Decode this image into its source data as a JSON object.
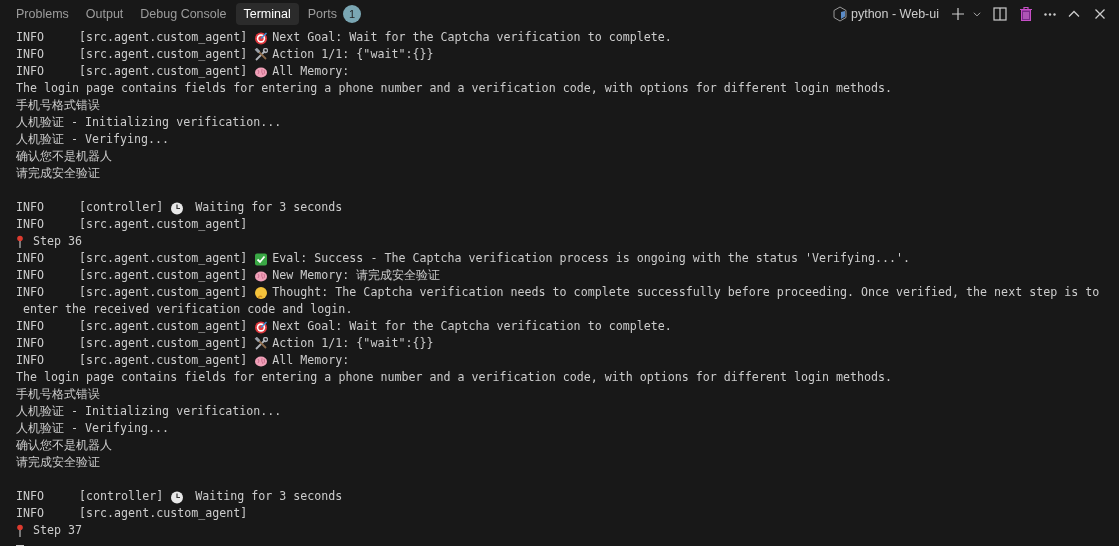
{
  "panel_tabs": [
    {
      "label": "Problems",
      "selected": false
    },
    {
      "label": "Output",
      "selected": false
    },
    {
      "label": "Debug Console",
      "selected": false
    },
    {
      "label": "Terminal",
      "selected": true
    },
    {
      "label": "Ports",
      "selected": false,
      "badge": "1"
    }
  ],
  "terminal_picker": {
    "label": "python - Web-ui"
  },
  "lines": [
    {
      "kind": "goal",
      "level": "INFO",
      "source": "[src.agent.custom_agent]",
      "text": "Next Goal: Wait for the Captcha verification to complete."
    },
    {
      "kind": "action",
      "level": "INFO",
      "source": "[src.agent.custom_agent]",
      "text": "Action 1/1: {\"wait\":{}}"
    },
    {
      "kind": "memory",
      "level": "INFO",
      "source": "[src.agent.custom_agent]",
      "text": "All Memory:"
    },
    {
      "kind": "plain",
      "text": "The login page contains fields for entering a phone number and a verification code, with options for different login methods."
    },
    {
      "kind": "plain",
      "text": "手机号格式错误"
    },
    {
      "kind": "plain",
      "text": "人机验证 - Initializing verification..."
    },
    {
      "kind": "plain",
      "text": "人机验证 - Verifying..."
    },
    {
      "kind": "plain",
      "text": "确认您不是机器人"
    },
    {
      "kind": "plain",
      "text": "请完成安全验证"
    },
    {
      "kind": "blank"
    },
    {
      "kind": "wait",
      "level": "INFO",
      "source": "[controller]",
      "text": " Waiting for 3 seconds"
    },
    {
      "kind": "log",
      "level": "INFO",
      "source": "[src.agent.custom_agent]"
    },
    {
      "kind": "step",
      "text": " Step 36"
    },
    {
      "kind": "eval",
      "level": "INFO",
      "source": "[src.agent.custom_agent]",
      "text": "Eval: Success - The Captcha verification process is ongoing with the status 'Verifying...'."
    },
    {
      "kind": "memory",
      "level": "INFO",
      "source": "[src.agent.custom_agent]",
      "text": "New Memory: 请完成安全验证"
    },
    {
      "kind": "thought",
      "level": "INFO",
      "source": "[src.agent.custom_agent]",
      "text": "Thought: The Captcha verification needs to complete successfully before proceeding. Once verified, the next step is to"
    },
    {
      "kind": "wrap",
      "text": "enter the received verification code and login."
    },
    {
      "kind": "goal",
      "level": "INFO",
      "source": "[src.agent.custom_agent]",
      "text": "Next Goal: Wait for the Captcha verification to complete."
    },
    {
      "kind": "action",
      "level": "INFO",
      "source": "[src.agent.custom_agent]",
      "text": "Action 1/1: {\"wait\":{}}"
    },
    {
      "kind": "memory",
      "level": "INFO",
      "source": "[src.agent.custom_agent]",
      "text": "All Memory:"
    },
    {
      "kind": "plain",
      "text": "The login page contains fields for entering a phone number and a verification code, with options for different login methods."
    },
    {
      "kind": "plain",
      "text": "手机号格式错误"
    },
    {
      "kind": "plain",
      "text": "人机验证 - Initializing verification..."
    },
    {
      "kind": "plain",
      "text": "人机验证 - Verifying..."
    },
    {
      "kind": "plain",
      "text": "确认您不是机器人"
    },
    {
      "kind": "plain",
      "text": "请完成安全验证"
    },
    {
      "kind": "blank"
    },
    {
      "kind": "wait",
      "level": "INFO",
      "source": "[controller]",
      "text": " Waiting for 3 seconds"
    },
    {
      "kind": "log",
      "level": "INFO",
      "source": "[src.agent.custom_agent]"
    },
    {
      "kind": "step",
      "text": " Step 37"
    },
    {
      "kind": "cursor"
    }
  ]
}
